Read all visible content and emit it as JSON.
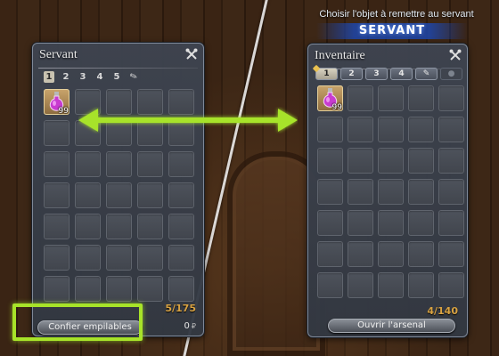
{
  "header": {
    "subtitle": "Choisir l'objet à remettre au servant",
    "banner": "SERVANT"
  },
  "servant": {
    "title": "Servant",
    "tabs": [
      "1",
      "2",
      "3",
      "4",
      "5"
    ],
    "active_tab": "1",
    "item_quantity": "99",
    "count": "5/175",
    "entrust_label": "Confier empilables",
    "gil_amount": "0",
    "gil_symbol": "₽"
  },
  "inventory": {
    "title": "Inventaire",
    "tabs": [
      "1",
      "2",
      "3",
      "4"
    ],
    "active_tab": "1",
    "item_quantity": "99",
    "count": "4/140",
    "armoury_label": "Ouvrir l'arsenal"
  },
  "icons": {
    "close": "crossed-tools-icon",
    "item": "potion-icon",
    "transfer": "double-arrow-icon",
    "crystal": "crystal-tab-icon",
    "bag": "bag-tab-icon"
  },
  "colors": {
    "highlight": "#a7e329",
    "count": "#d8a242",
    "banner": "#1e46aa"
  }
}
